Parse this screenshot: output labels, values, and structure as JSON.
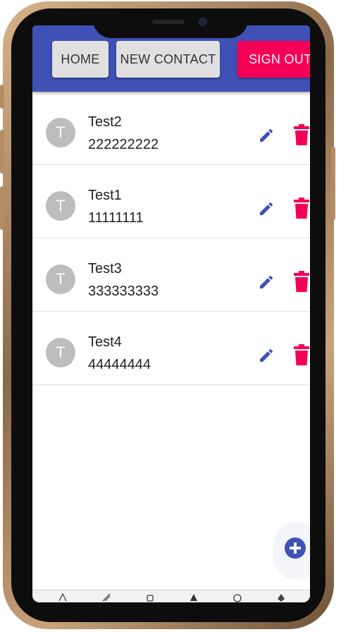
{
  "app_bar": {
    "home_label": "HOME",
    "new_contact_label": "NEW CONTACT",
    "sign_out_label": "SIGN OUT"
  },
  "contacts": [
    {
      "initial": "T",
      "name": "Test2",
      "phone": "222222222"
    },
    {
      "initial": "T",
      "name": "Test1",
      "phone": "11111111"
    },
    {
      "initial": "T",
      "name": "Test3",
      "phone": "333333333"
    },
    {
      "initial": "T",
      "name": "Test4",
      "phone": "44444444"
    }
  ],
  "icons": {
    "edit": "pencil-icon",
    "delete": "trash-icon",
    "add": "plus-icon"
  },
  "colors": {
    "primary": "#3f51b5",
    "secondary": "#f50057",
    "avatar": "#bdbdbd"
  }
}
